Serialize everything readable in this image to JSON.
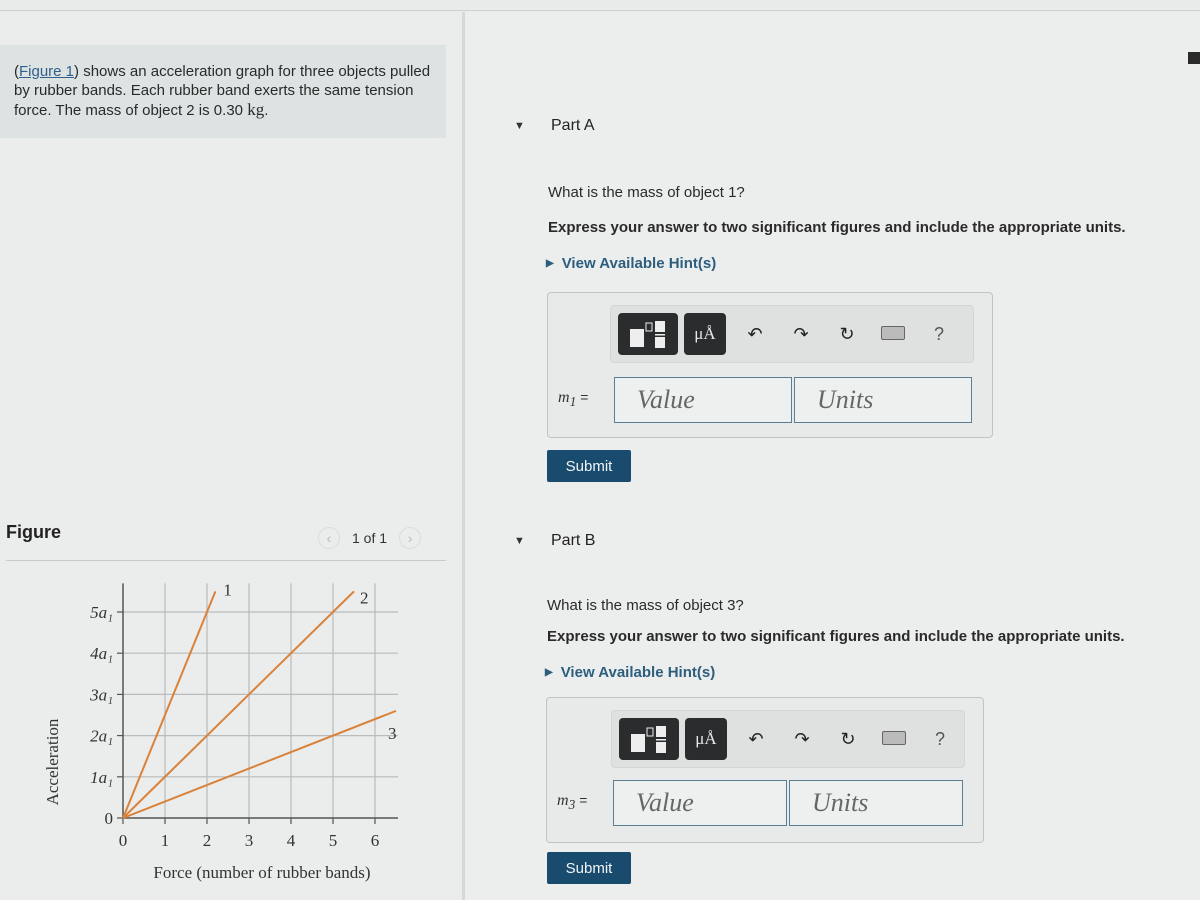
{
  "intro": {
    "figure_link": "Figure 1",
    "text_before": "(",
    "text_after": ") shows an acceleration graph for three objects pulled by rubber bands. Each rubber band exerts the same tension force. The mass of object 2 is 0.30 ",
    "unit": "kg",
    "period": "."
  },
  "figure": {
    "title": "Figure",
    "prev_icon": "‹",
    "next_icon": "›",
    "count": "1 of 1"
  },
  "chart_data": {
    "type": "line",
    "title": "",
    "xlabel": "Force (number of rubber bands)",
    "ylabel": "Acceleration",
    "xlim": [
      0,
      6.5
    ],
    "ylim": [
      0,
      5.5
    ],
    "x_ticks": [
      "0",
      "1",
      "2",
      "3",
      "4",
      "5",
      "6"
    ],
    "y_ticks": [
      "0",
      "1a₁",
      "2a₁",
      "3a₁",
      "4a₁",
      "5a₁"
    ],
    "grid": true,
    "line_color": "#d9823a",
    "series": [
      {
        "name": "1",
        "x": [
          0,
          2.2
        ],
        "y": [
          0,
          5.5
        ]
      },
      {
        "name": "2",
        "x": [
          0,
          5.5
        ],
        "y": [
          0,
          5.5
        ]
      },
      {
        "name": "3",
        "x": [
          0,
          6.5
        ],
        "y": [
          0,
          2.6
        ]
      }
    ]
  },
  "parts": [
    {
      "title": "Part A",
      "question": "What is the mass of object 1?",
      "instruction": "Express your answer to two significant figures and include the appropriate units.",
      "hint": "View Available Hint(s)",
      "variable": "m",
      "subscript": "1",
      "equals": "=",
      "value_placeholder": "Value",
      "units_placeholder": "Units",
      "submit": "Submit"
    },
    {
      "title": "Part B",
      "question": "What is the mass of object 3?",
      "instruction": "Express your answer to two significant figures and include the appropriate units.",
      "hint": "View Available Hint(s)",
      "variable": "m",
      "subscript": "3",
      "equals": "=",
      "value_placeholder": "Value",
      "units_placeholder": "Units",
      "submit": "Submit"
    }
  ],
  "toolbar": {
    "units_label": "μÅ",
    "undo_icon": "↶",
    "redo_icon": "↷",
    "reset_icon": "↻",
    "help_icon": "?"
  }
}
